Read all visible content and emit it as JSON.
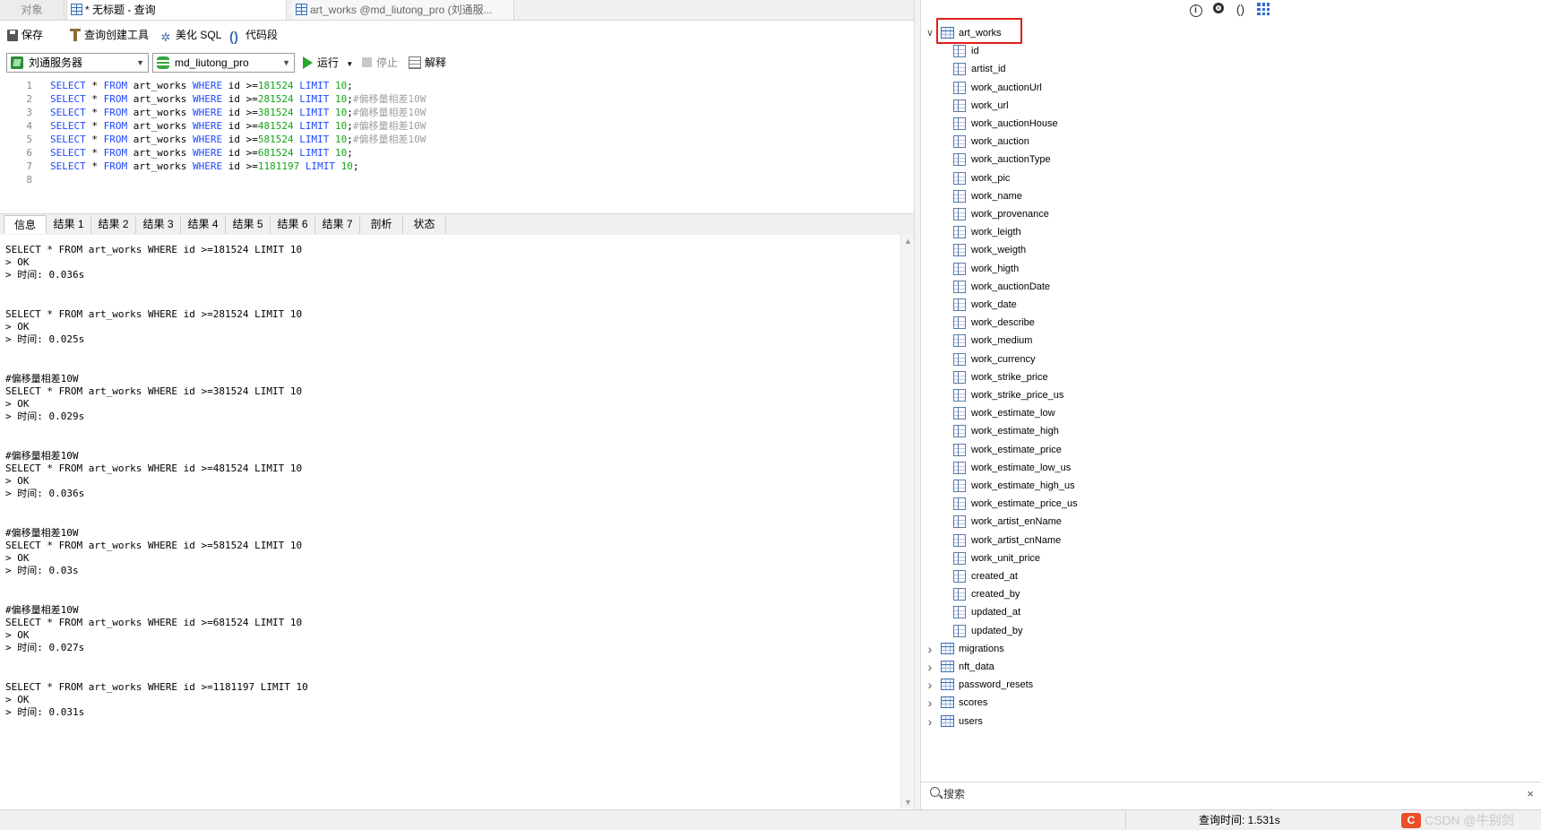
{
  "tabs": {
    "objects": "对象",
    "query": "* 无标题 - 查询",
    "table": "art_works @md_liutong_pro (刘通服..."
  },
  "toolbar": {
    "save": "保存",
    "query_builder": "查询创建工具",
    "beautify": "美化 SQL",
    "snippet": "代码段"
  },
  "toolbar2": {
    "server": "刘通服务器",
    "database": "md_liutong_pro",
    "run": "运行",
    "stop": "停止",
    "explain": "解释"
  },
  "editor": {
    "lines": [
      {
        "n": "1",
        "id": "181524",
        "comment": ""
      },
      {
        "n": "2",
        "id": "281524",
        "comment": "#偏移量相差10W"
      },
      {
        "n": "3",
        "id": "381524",
        "comment": "#偏移量相差10W"
      },
      {
        "n": "4",
        "id": "481524",
        "comment": "#偏移量相差10W"
      },
      {
        "n": "5",
        "id": "581524",
        "comment": "#偏移量相差10W"
      },
      {
        "n": "6",
        "id": "681524",
        "comment": ""
      },
      {
        "n": "7",
        "id": "1181197",
        "comment": ""
      },
      {
        "n": "8",
        "id": "",
        "comment": ""
      }
    ],
    "kw_select": "SELECT",
    "star": "*",
    "kw_from": "FROM",
    "table": "art_works",
    "kw_where": "WHERE",
    "col": "id",
    "op": ">=",
    "kw_limit": "LIMIT",
    "limit": "10"
  },
  "result_tabs": [
    "信息",
    "结果 1",
    "结果 2",
    "结果 3",
    "结果 4",
    "结果 5",
    "结果 6",
    "结果 7",
    "剖析",
    "状态"
  ],
  "log": [
    {
      "comment": "",
      "sql": "SELECT * FROM art_works WHERE id >=181524 LIMIT 10",
      "ok": "> OK",
      "time": "> 时间: 0.036s"
    },
    {
      "comment": "",
      "sql": "SELECT * FROM art_works WHERE id >=281524 LIMIT 10",
      "ok": "> OK",
      "time": "> 时间: 0.025s"
    },
    {
      "comment": "#偏移量相差10W",
      "sql": "SELECT * FROM art_works WHERE id >=381524 LIMIT 10",
      "ok": "> OK",
      "time": "> 时间: 0.029s"
    },
    {
      "comment": "#偏移量相差10W",
      "sql": "SELECT * FROM art_works WHERE id >=481524 LIMIT 10",
      "ok": "> OK",
      "time": "> 时间: 0.036s"
    },
    {
      "comment": "#偏移量相差10W",
      "sql": "SELECT * FROM art_works WHERE id >=581524 LIMIT 10",
      "ok": "> OK",
      "time": "> 时间: 0.03s"
    },
    {
      "comment": "#偏移量相差10W",
      "sql": "SELECT * FROM art_works WHERE id >=681524 LIMIT 10",
      "ok": "> OK",
      "time": "> 时间: 0.027s"
    },
    {
      "comment": "",
      "sql": "SELECT * FROM art_works WHERE id >=1181197 LIMIT 10",
      "ok": "> OK",
      "time": "> 时间: 0.031s"
    }
  ],
  "tree": {
    "expanded_table": "art_works",
    "columns": [
      "id",
      "artist_id",
      "work_auctionUrl",
      "work_url",
      "work_auctionHouse",
      "work_auction",
      "work_auctionType",
      "work_pic",
      "work_name",
      "work_provenance",
      "work_leigth",
      "work_weigth",
      "work_higth",
      "work_auctionDate",
      "work_date",
      "work_describe",
      "work_medium",
      "work_currency",
      "work_strike_price",
      "work_strike_price_us",
      "work_estimate_low",
      "work_estimate_high",
      "work_estimate_price",
      "work_estimate_low_us",
      "work_estimate_high_us",
      "work_estimate_price_us",
      "work_artist_enName",
      "work_artist_cnName",
      "work_unit_price",
      "created_at",
      "created_by",
      "updated_at",
      "updated_by"
    ],
    "other_tables": [
      "migrations",
      "nft_data",
      "password_resets",
      "scores",
      "users"
    ]
  },
  "search": {
    "label": "搜索"
  },
  "status": {
    "query_time": "查询时间: 1.531s",
    "watermark": "CSDN @牛别剑"
  },
  "icons": {
    "info": "info-icon",
    "preview": "eye-icon",
    "ddl": "parentheses-icon",
    "grid": "grid-icon"
  },
  "colors": {
    "keyword": "#1f49ff",
    "number": "#14a514",
    "comment": "#a0a0a0",
    "highlight": "#e0201a",
    "run": "#2fa52f"
  }
}
